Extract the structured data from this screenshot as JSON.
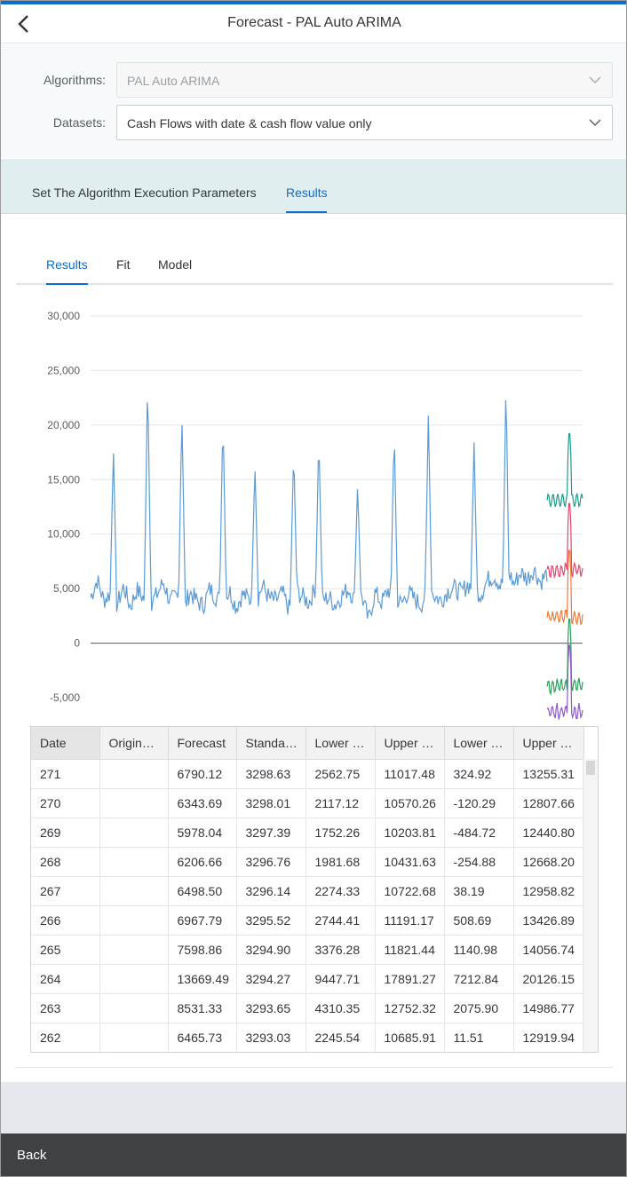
{
  "header": {
    "title": "Forecast - PAL Auto ARIMA"
  },
  "form": {
    "algorithms_label": "Algorithms:",
    "algorithms_value": "PAL Auto ARIMA",
    "datasets_label": "Datasets:",
    "datasets_value": "Cash Flows with date & cash flow value only"
  },
  "tabs": [
    {
      "label": "Set The Algorithm Execution Parameters",
      "active": false
    },
    {
      "label": "Results",
      "active": true
    }
  ],
  "subtabs": [
    {
      "label": "Results",
      "active": true
    },
    {
      "label": "Fit",
      "active": false
    },
    {
      "label": "Model",
      "active": false
    }
  ],
  "chart_data": {
    "type": "line",
    "ylim": [
      -5000,
      30000
    ],
    "yticks": [
      "30,000",
      "25,000",
      "20,000",
      "15,000",
      "10,000",
      "5,000",
      "0",
      "-5,000"
    ],
    "ytick_values": [
      30000,
      25000,
      20000,
      15000,
      10000,
      5000,
      0,
      -5000
    ],
    "grid": true,
    "x": {
      "start": 1,
      "end": 271
    },
    "series": [
      {
        "values_note": "",
        "color": "#5b9bd5",
        "baseline": [
          4200,
          5800,
          3900,
          4600,
          3500,
          5200,
          3300,
          4900,
          4100,
          3600,
          4400,
          5600,
          3800,
          4300,
          2900,
          4700,
          3900,
          3400,
          5000,
          4200,
          3700,
          4800,
          3300,
          4500,
          4000,
          3600,
          5300,
          4100,
          3900,
          4600,
          3100,
          4800,
          4300,
          3700,
          5100,
          3900,
          4200,
          3500,
          4400,
          5000,
          3800,
          4300,
          2100,
          4600,
          3700,
          4900,
          4200,
          3600,
          4700,
          4000,
          3500,
          5200,
          4300,
          3900,
          4800,
          5000,
          4600,
          5400,
          4900,
          4500,
          5800,
          6200,
          5200,
          6800,
          5400,
          6500,
          5900,
          6800,
          5600,
          6400
        ],
        "peaks": [
          {
            "at": 0.05,
            "value": 17600
          },
          {
            "at": 0.125,
            "value": 24600
          },
          {
            "at": 0.2,
            "value": 21100
          },
          {
            "at": 0.29,
            "value": 20700
          },
          {
            "at": 0.36,
            "value": 16400
          },
          {
            "at": 0.445,
            "value": 17900
          },
          {
            "at": 0.5,
            "value": 19200
          },
          {
            "at": 0.585,
            "value": 14500
          },
          {
            "at": 0.665,
            "value": 19600
          },
          {
            "at": 0.74,
            "value": 21200
          },
          {
            "at": 0.84,
            "value": 18600
          },
          {
            "at": 0.91,
            "value": 24200
          }
        ]
      },
      {
        "color": "#1a9c8a",
        "forecast_level": 20100
      },
      {
        "color": "#e0456b",
        "forecast_level": 13700
      },
      {
        "color": "#f07936",
        "forecast_level": 9400
      },
      {
        "color": "#2ca05a",
        "forecast_level": 3100
      },
      {
        "color": "#8e5cc7",
        "forecast_level": 700
      }
    ]
  },
  "table": {
    "columns": [
      "Date",
      "Origin…",
      "Forecast",
      "Standa…",
      "Lower …",
      "Upper …",
      "Lower …",
      "Upper …"
    ],
    "rows": [
      [
        "271",
        "",
        "6790.12",
        "3298.63",
        "2562.75",
        "11017.48",
        "324.92",
        "13255.31"
      ],
      [
        "270",
        "",
        "6343.69",
        "3298.01",
        "2117.12",
        "10570.26",
        "-120.29",
        "12807.66"
      ],
      [
        "269",
        "",
        "5978.04",
        "3297.39",
        "1752.26",
        "10203.81",
        "-484.72",
        "12440.80"
      ],
      [
        "268",
        "",
        "6206.66",
        "3296.76",
        "1981.68",
        "10431.63",
        "-254.88",
        "12668.20"
      ],
      [
        "267",
        "",
        "6498.50",
        "3296.14",
        "2274.33",
        "10722.68",
        "38.19",
        "12958.82"
      ],
      [
        "266",
        "",
        "6967.79",
        "3295.52",
        "2744.41",
        "11191.17",
        "508.69",
        "13426.89"
      ],
      [
        "265",
        "",
        "7598.86",
        "3294.90",
        "3376.28",
        "11821.44",
        "1140.98",
        "14056.74"
      ],
      [
        "264",
        "",
        "13669.49",
        "3294.27",
        "9447.71",
        "17891.27",
        "7212.84",
        "20126.15"
      ],
      [
        "263",
        "",
        "8531.33",
        "3293.65",
        "4310.35",
        "12752.32",
        "2075.90",
        "14986.77"
      ],
      [
        "262",
        "",
        "6465.73",
        "3293.03",
        "2245.54",
        "10685.91",
        "11.51",
        "12919.94"
      ]
    ]
  },
  "footer": {
    "back_label": "Back"
  }
}
